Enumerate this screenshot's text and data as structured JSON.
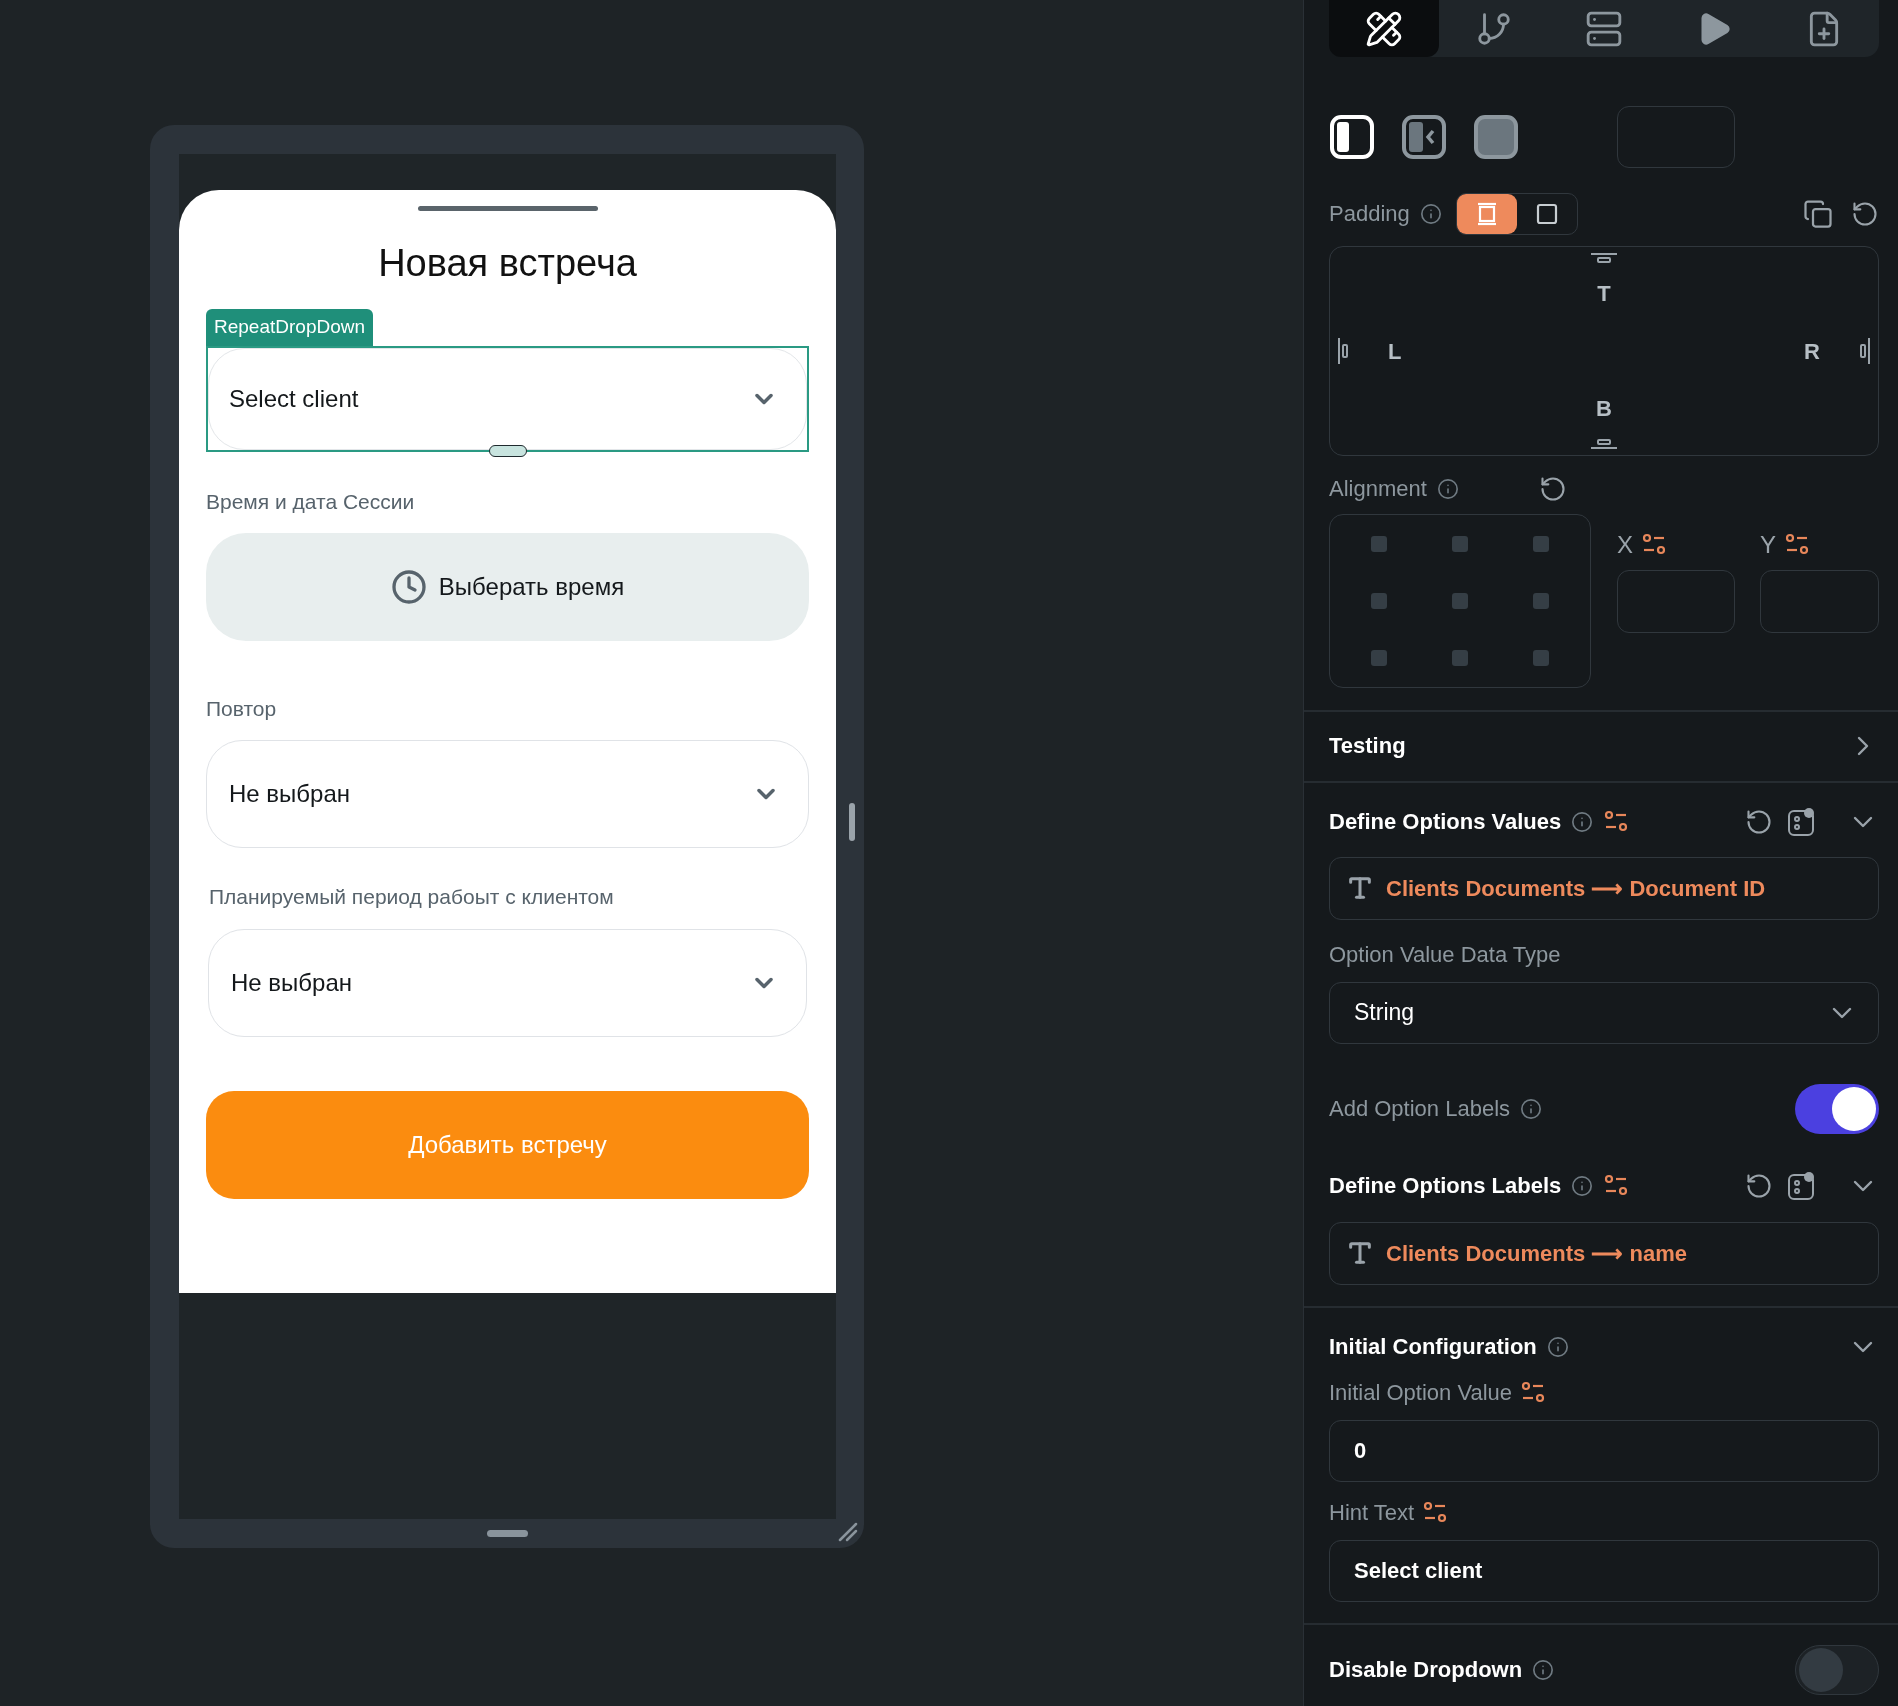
{
  "canvas": {
    "phone": {
      "sheet": {
        "title": "Новая встреча",
        "widget_tag": "RepeatDropDown",
        "client_dropdown": {
          "placeholder": "Select client"
        },
        "session_label": "Время и дата Сессии",
        "time_button": "Выберать время",
        "repeat_label": "Повтор",
        "repeat_dropdown": {
          "value": "Не выбран"
        },
        "period_label": "Планируемый период рабоыт с клиентом",
        "period_dropdown": {
          "value": "Не выбран"
        },
        "submit_button": "Добавить встречу"
      }
    }
  },
  "panel": {
    "toolbar_tabs": [
      {
        "kind": "design",
        "selected": true
      },
      {
        "kind": "logic",
        "selected": false
      },
      {
        "kind": "data",
        "selected": false
      },
      {
        "kind": "run",
        "selected": false
      },
      {
        "kind": "notes",
        "selected": false
      }
    ],
    "layout_options": [
      {
        "kind": "half",
        "selected": true
      },
      {
        "kind": "collapse",
        "selected": false
      },
      {
        "kind": "full",
        "selected": false
      }
    ],
    "padding": {
      "label": "Padding",
      "modes": [
        {
          "kind": "all",
          "selected": true
        },
        {
          "kind": "single",
          "selected": false
        }
      ],
      "top": "T",
      "left": "L",
      "right": "R",
      "bottom": "B"
    },
    "alignment": {
      "label": "Alignment",
      "x_label": "X",
      "y_label": "Y"
    },
    "testing": {
      "title": "Testing",
      "expanded": false
    },
    "define_values": {
      "title": "Define Options Values",
      "expanded": true,
      "value": "Clients Documents ⟶ Document ID"
    },
    "value_data_type": {
      "label": "Option Value Data Type",
      "value": "String"
    },
    "add_option_labels": {
      "label": "Add Option Labels",
      "on": true
    },
    "define_labels": {
      "title": "Define Options Labels",
      "expanded": true,
      "value": "Clients Documents ⟶ name"
    },
    "initial_configuration": {
      "title": "Initial Configuration",
      "expanded": true,
      "initial_option_value": {
        "label": "Initial Option Value",
        "value": "0"
      },
      "hint_text": {
        "label": "Hint Text",
        "value": "Select client"
      }
    },
    "disable_dropdown": {
      "label": "Disable Dropdown",
      "on": false
    }
  }
}
